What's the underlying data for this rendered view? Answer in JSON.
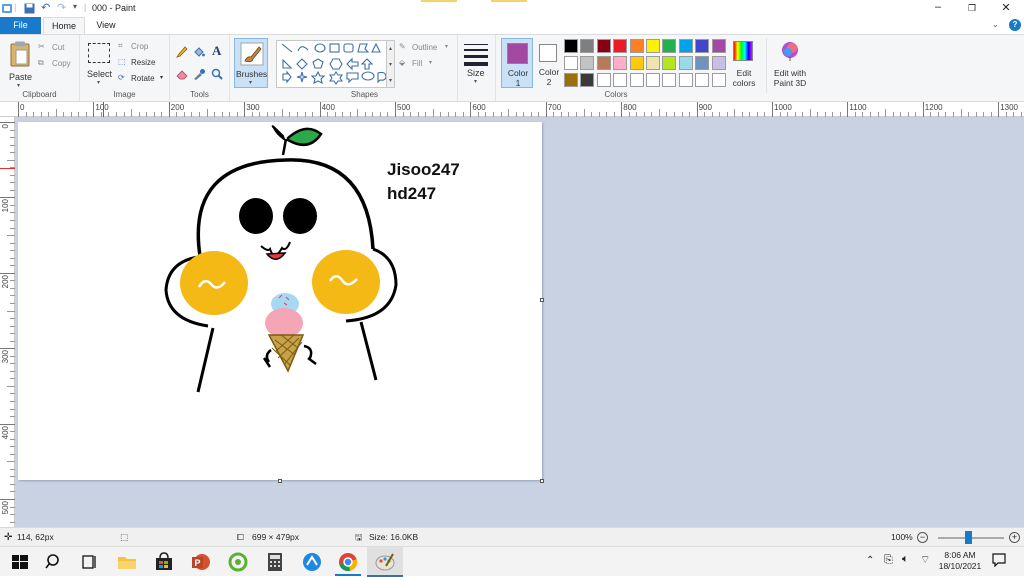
{
  "window": {
    "title": "000 - Paint"
  },
  "tabs": {
    "file": "File",
    "home": "Home",
    "view": "View"
  },
  "clipboard": {
    "paste": "Paste",
    "cut": "Cut",
    "copy": "Copy",
    "label": "Clipboard"
  },
  "image": {
    "select": "Select",
    "crop": "Crop",
    "resize": "Resize",
    "rotate": "Rotate",
    "label": "Image"
  },
  "tools": {
    "label": "Tools"
  },
  "brushes": {
    "label": "Brushes"
  },
  "shapes": {
    "label": "Shapes",
    "outline": "Outline",
    "fill": "Fill"
  },
  "size": {
    "label": "Size"
  },
  "colors": {
    "color1": "Color 1",
    "color2": "Color 2",
    "edit_colors": "Edit colors",
    "edit_paint3d": "Edit with Paint 3D",
    "label": "Colors",
    "color1_value": "#a349a4",
    "color2_value": "#ffffff",
    "palette_row1": [
      "#000000",
      "#7f7f7f",
      "#880015",
      "#ed1c24",
      "#ff7f27",
      "#fff200",
      "#22b14c",
      "#00a2e8",
      "#3f48cc",
      "#a349a4"
    ],
    "palette_row2": [
      "#ffffff",
      "#c3c3c3",
      "#b97a57",
      "#ffaec9",
      "#ffc90e",
      "#efe4b0",
      "#b5e61d",
      "#99d9ea",
      "#7092be",
      "#c8bfe7"
    ],
    "palette_row3": [
      "#9c6f0e",
      "#3a3a3a",
      "#ffffff",
      "#ffffff",
      "#ffffff",
      "#ffffff",
      "#ffffff",
      "#ffffff",
      "#ffffff",
      "#ffffff"
    ]
  },
  "ruler": {
    "top": [
      "0",
      "100",
      "200",
      "300",
      "400",
      "500",
      "600",
      "700",
      "800",
      "900",
      "1000",
      "1100",
      "1200",
      "1300"
    ],
    "left": [
      "0",
      "100",
      "200",
      "300",
      "400",
      "500"
    ]
  },
  "drawing": {
    "text_line1": "Jisoo247",
    "text_line2": "hd247"
  },
  "status": {
    "cursor": "114, 62px",
    "dimensions": "699 × 479px",
    "size": "Size: 16.0KB",
    "zoom": "100%"
  },
  "taskbar": {
    "time": "8:06 AM",
    "date": "18/10/2021"
  }
}
